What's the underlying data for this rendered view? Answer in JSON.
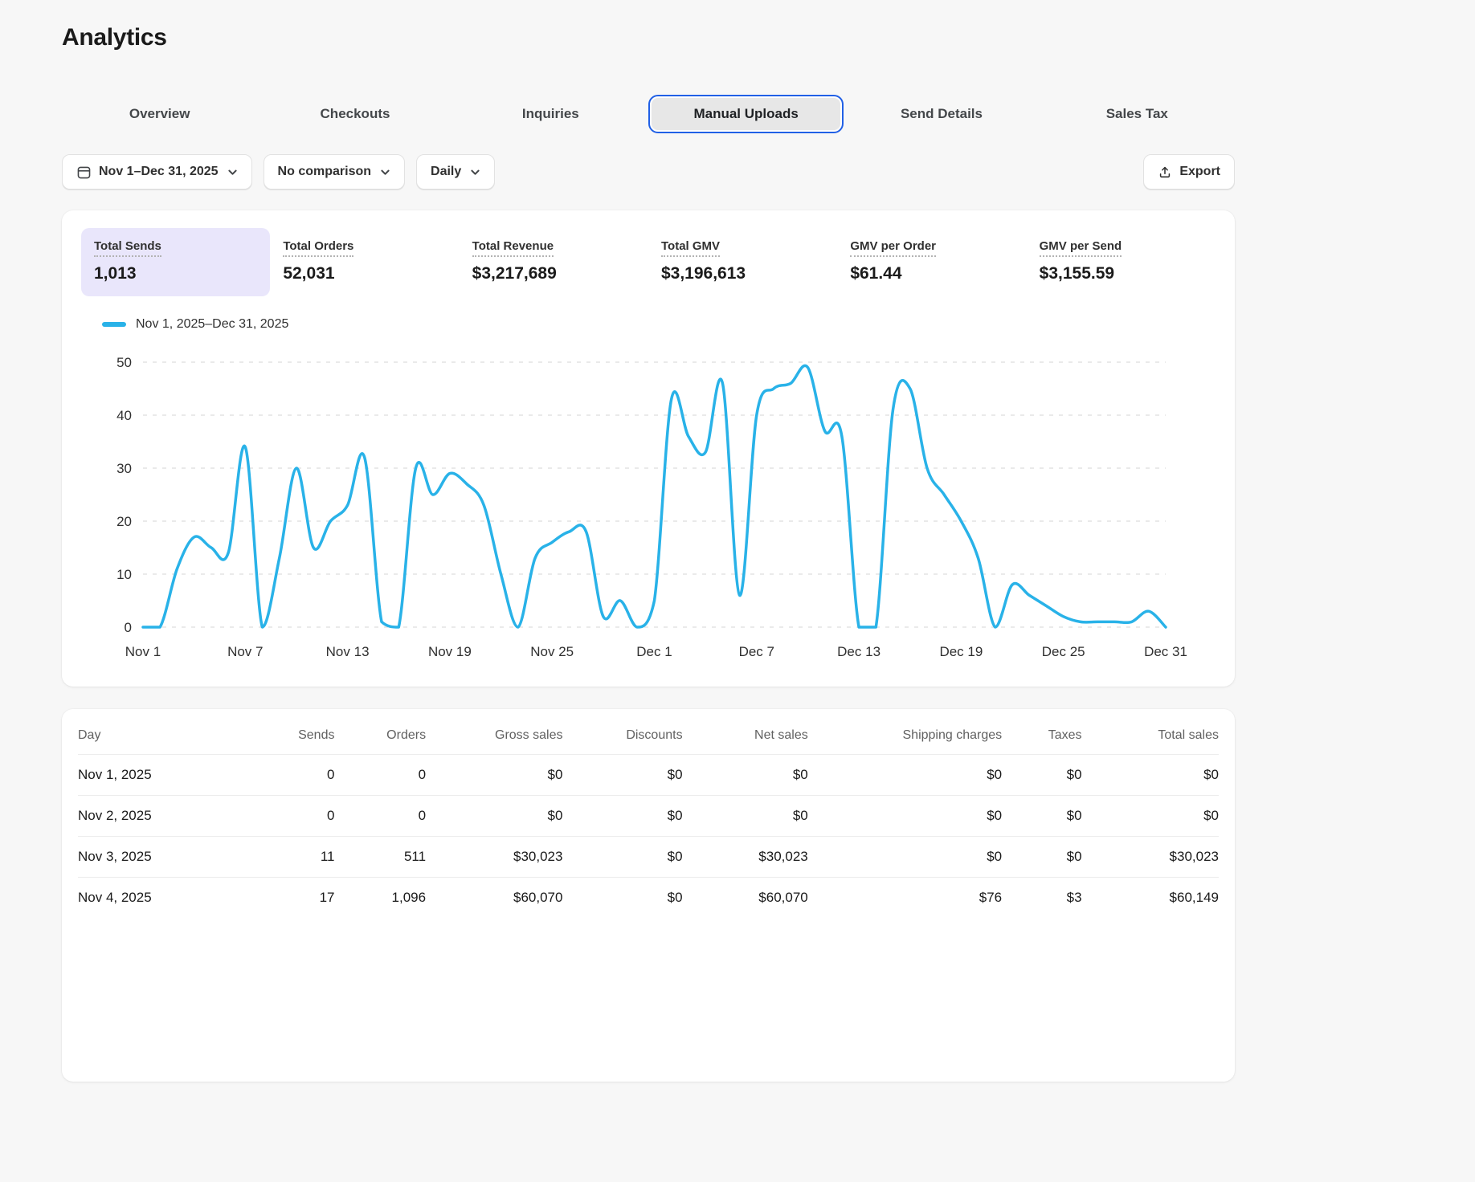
{
  "page": {
    "title": "Analytics"
  },
  "tabs": [
    {
      "label": "Overview",
      "active": false
    },
    {
      "label": "Checkouts",
      "active": false
    },
    {
      "label": "Inquiries",
      "active": false
    },
    {
      "label": "Manual Uploads",
      "active": true
    },
    {
      "label": "Send Details",
      "active": false
    },
    {
      "label": "Sales Tax",
      "active": false
    }
  ],
  "filters": {
    "date_range": "Nov 1–Dec 31, 2025",
    "comparison": "No comparison",
    "granularity": "Daily",
    "export_label": "Export"
  },
  "metrics": [
    {
      "label": "Total Sends",
      "value": "1,013",
      "selected": true
    },
    {
      "label": "Total Orders",
      "value": "52,031",
      "selected": false
    },
    {
      "label": "Total Revenue",
      "value": "$3,217,689",
      "selected": false
    },
    {
      "label": "Total GMV",
      "value": "$3,196,613",
      "selected": false
    },
    {
      "label": "GMV per Order",
      "value": "$61.44",
      "selected": false
    },
    {
      "label": "GMV per Send",
      "value": "$3,155.59",
      "selected": false
    }
  ],
  "legend": {
    "label": "Nov 1, 2025–Dec 31, 2025"
  },
  "colors": {
    "line": "#29b2e8",
    "selected_metric_bg": "#e9e6fb",
    "active_tab_border": "#2160e6"
  },
  "chart_data": {
    "type": "line",
    "title": "Total Sends by day",
    "series_name": "Nov 1, 2025–Dec 31, 2025",
    "x": [
      "Nov 1",
      "Nov 2",
      "Nov 3",
      "Nov 4",
      "Nov 5",
      "Nov 6",
      "Nov 7",
      "Nov 8",
      "Nov 9",
      "Nov 10",
      "Nov 11",
      "Nov 12",
      "Nov 13",
      "Nov 14",
      "Nov 15",
      "Nov 16",
      "Nov 17",
      "Nov 18",
      "Nov 19",
      "Nov 20",
      "Nov 21",
      "Nov 22",
      "Nov 23",
      "Nov 24",
      "Nov 25",
      "Nov 26",
      "Nov 27",
      "Nov 28",
      "Nov 29",
      "Nov 30",
      "Dec 1",
      "Dec 2",
      "Dec 3",
      "Dec 4",
      "Dec 5",
      "Dec 6",
      "Dec 7",
      "Dec 8",
      "Dec 9",
      "Dec 10",
      "Dec 11",
      "Dec 12",
      "Dec 13",
      "Dec 14",
      "Dec 15",
      "Dec 16",
      "Dec 17",
      "Dec 18",
      "Dec 19",
      "Dec 20",
      "Dec 21",
      "Dec 22",
      "Dec 23",
      "Dec 24",
      "Dec 25",
      "Dec 26",
      "Dec 27",
      "Dec 28",
      "Dec 29",
      "Dec 30",
      "Dec 31"
    ],
    "values": [
      0,
      0,
      11,
      17,
      15,
      14,
      34,
      0,
      13,
      30,
      15,
      20,
      23,
      32,
      1,
      0,
      30,
      25,
      29,
      27,
      23,
      10,
      0,
      13,
      16,
      18,
      18,
      2,
      5,
      0,
      5,
      43,
      36,
      33,
      46,
      6,
      40,
      45,
      46,
      49,
      37,
      36,
      0,
      0,
      41,
      45,
      30,
      25,
      20,
      13,
      0,
      8,
      6,
      4,
      2,
      1,
      1,
      1,
      1,
      3,
      0
    ],
    "x_ticks": [
      "Nov 1",
      "Nov 7",
      "Nov 13",
      "Nov 19",
      "Nov 25",
      "Dec 1",
      "Dec 7",
      "Dec 13",
      "Dec 19",
      "Dec 25",
      "Dec 31"
    ],
    "x_tick_positions": [
      0,
      6,
      12,
      18,
      24,
      30,
      36,
      42,
      48,
      54,
      60
    ],
    "y_ticks": [
      0,
      10,
      20,
      30,
      40,
      50
    ],
    "ylim": [
      0,
      50
    ],
    "xlabel": "",
    "ylabel": "",
    "line_color": "#29b2e8",
    "grid": "dashed-horizontal",
    "legend_position": "top-left"
  },
  "table": {
    "headers": [
      "Day",
      "Sends",
      "Orders",
      "Gross sales",
      "Discounts",
      "Net sales",
      "Shipping charges",
      "Taxes",
      "Total sales"
    ],
    "rows": [
      [
        "Nov 1, 2025",
        "0",
        "0",
        "$0",
        "$0",
        "$0",
        "$0",
        "$0",
        "$0"
      ],
      [
        "Nov 2, 2025",
        "0",
        "0",
        "$0",
        "$0",
        "$0",
        "$0",
        "$0",
        "$0"
      ],
      [
        "Nov 3, 2025",
        "11",
        "511",
        "$30,023",
        "$0",
        "$30,023",
        "$0",
        "$0",
        "$30,023"
      ],
      [
        "Nov 4, 2025",
        "17",
        "1,096",
        "$60,070",
        "$0",
        "$60,070",
        "$76",
        "$3",
        "$60,149"
      ]
    ]
  }
}
